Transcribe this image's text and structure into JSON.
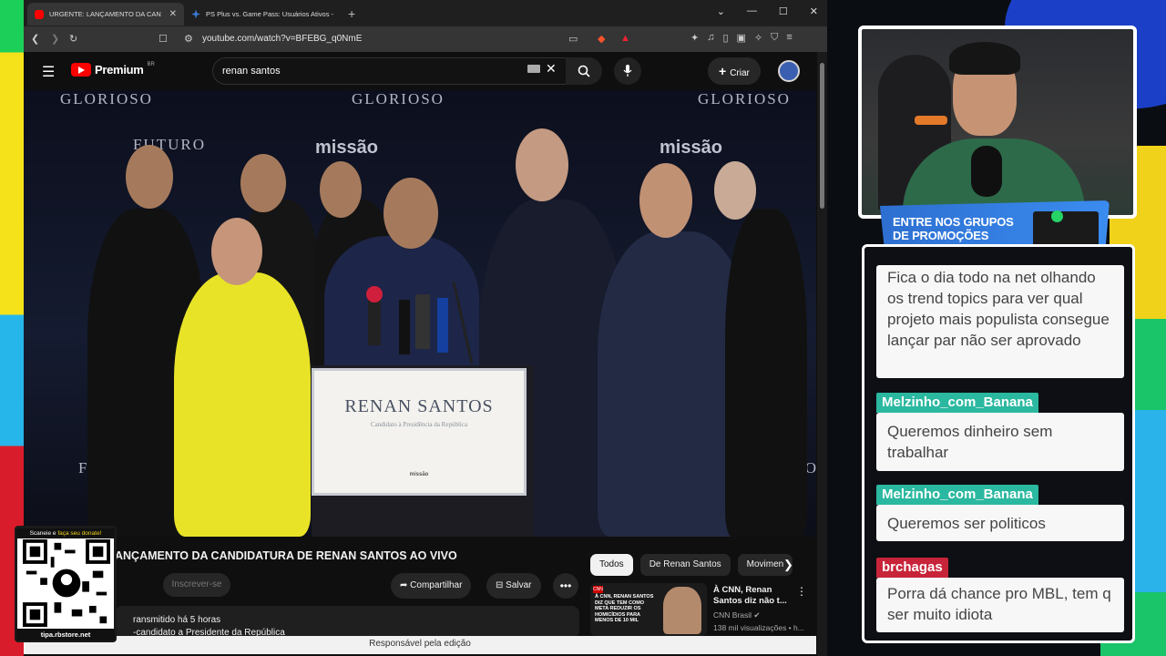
{
  "browser": {
    "tabs": [
      {
        "title": "URGENTE: LANÇAMENTO DA CAN",
        "active": true
      },
      {
        "title": "PS Plus vs. Game Pass: Usuários Ativos - Goo",
        "active": false
      }
    ],
    "url": "youtube.com/watch?v=BFEBG_q0NmE"
  },
  "youtube": {
    "logo": "Premium",
    "region": "BR",
    "search_value": "renan santos",
    "create_label": "Criar"
  },
  "video": {
    "podium_name": "RENAN SANTOS",
    "podium_subtitle": "Candidato à Presidência da República",
    "podium_logo": "missão",
    "backdrop_words": [
      "GLORIOSO",
      "FUTURO",
      "missão"
    ],
    "title": "ANÇAMENTO DA CANDIDATURA DE RENAN SANTOS AO VIVO",
    "subscribe_label": "Inscrever-se",
    "share_label": "Compartilhar",
    "save_label": "Salvar",
    "desc_line1": "ransmitido há 5 horas",
    "desc_line2": "-candidato a Presidente da República"
  },
  "related": {
    "chips": [
      "Todos",
      "De Renan Santos",
      "Movimen"
    ],
    "item": {
      "title": "À CNN, Renan Santos diz não t...",
      "channel": "CNN Brasil",
      "meta": "138 mil visualizações • h...",
      "thumb_text": "À CNN, RENAN SANTOS DIZ QUE TEM COMO META REDUZIR OS HOMICÍDIOS PARA MENOS DE 10 MIL",
      "thumb_badge": "CNN"
    }
  },
  "status_text": "Responsável pela edição",
  "qr": {
    "header_pre": "Scaneie e ",
    "header_link": "faça seu donate!",
    "footer": "tipa.rbstore.net"
  },
  "stream": {
    "promo_line1": "ENTRE NOS GRUPOS",
    "promo_line2": "DE PROMOÇÕES"
  },
  "chat": [
    {
      "user": "",
      "text": "Fica o dia todo na net olhando os trend topics para ver qual projeto mais populista consegue lançar par não ser aprovado"
    },
    {
      "user": "Melzinho_com_Banana",
      "text": "Queremos dinheiro sem trabalhar"
    },
    {
      "user": "Melzinho_com_Banana",
      "text": "Queremos ser politicos"
    },
    {
      "user": "brchagas",
      "text": "Porra dá chance pro MBL, tem q ser muito idiota"
    }
  ]
}
